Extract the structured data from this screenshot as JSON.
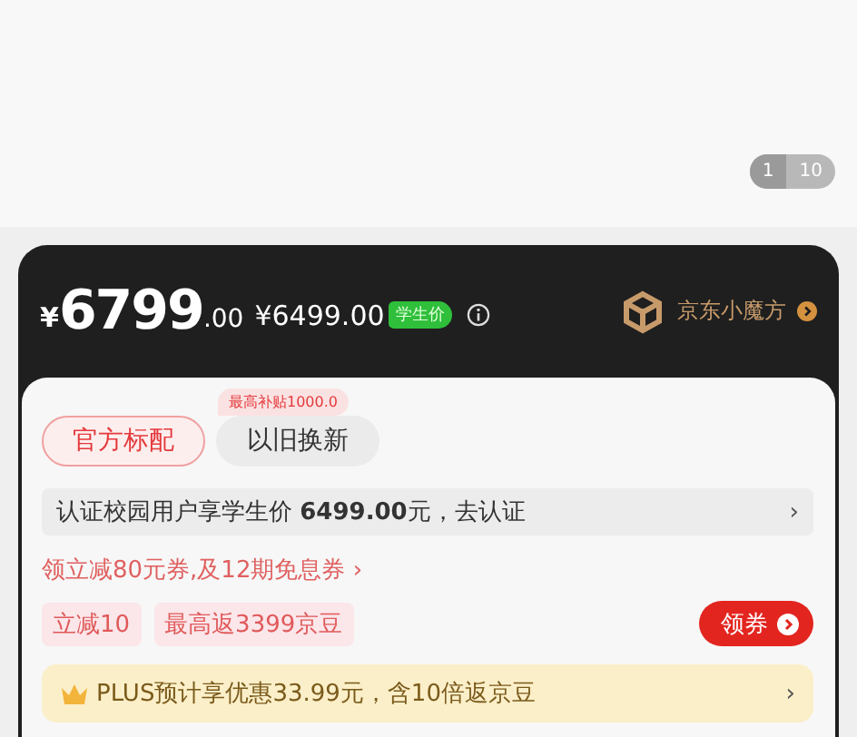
{
  "pager": {
    "current": "1",
    "total": "10"
  },
  "price": {
    "currency": "¥",
    "integer": "6799",
    "decimal": ".00",
    "student_price": "¥6499.00",
    "student_badge": "学生价",
    "brand": "京东小魔方"
  },
  "options": [
    {
      "label": "官方标配",
      "selected": true
    },
    {
      "label": "以旧换新",
      "selected": false,
      "badge": "最高补贴1000.0"
    }
  ],
  "student_notice": {
    "text": "认证校园用户享学生价 **6499.00**元，去认证",
    "arrow": "›"
  },
  "coupon_line": "领立减80元券,及12期免息券 ›",
  "promo_tags": [
    "立减10",
    "最高返3399京豆"
  ],
  "coupon_button": "领券",
  "plus_bar": {
    "text": "PLUS预计享优惠33.99元，含10倍返京豆",
    "arrow": "›"
  }
}
